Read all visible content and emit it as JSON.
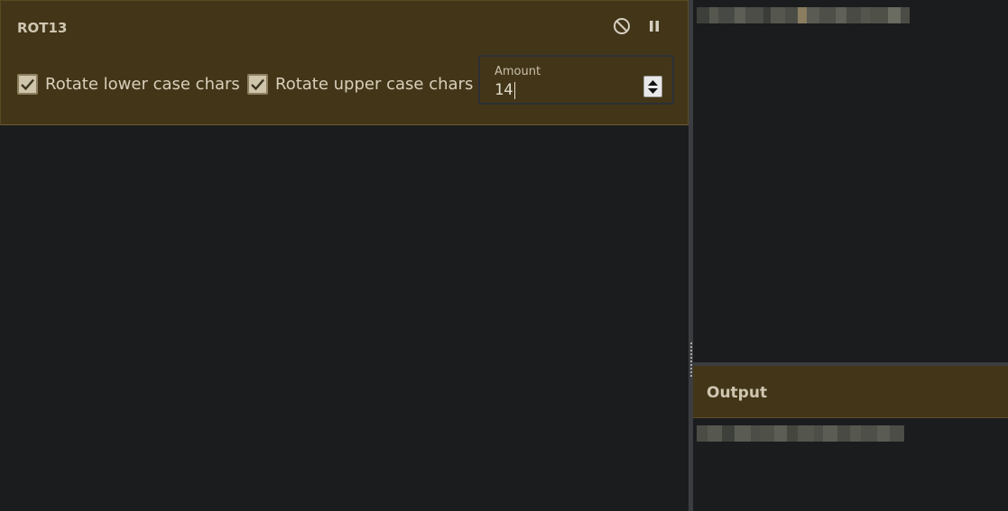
{
  "operation": {
    "title": "ROT13",
    "disable_icon": "disable-icon",
    "pause_icon": "pause-icon",
    "rotate_lower": {
      "label": "Rotate lower case chars",
      "checked": true
    },
    "rotate_upper": {
      "label": "Rotate upper case chars",
      "checked": true
    },
    "amount": {
      "label": "Amount",
      "value": "14"
    }
  },
  "output": {
    "title": "Output"
  },
  "colors": {
    "operation_bg": "#433618",
    "pane_bg": "#1b1c1e",
    "text": "#d8cfbb"
  }
}
